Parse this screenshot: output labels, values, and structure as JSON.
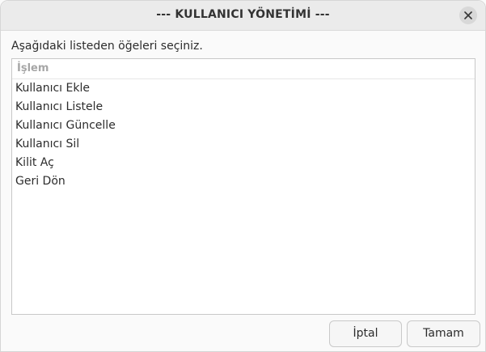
{
  "window": {
    "title": "--- KULLANICI YÖNETİMİ ---",
    "close_icon": "close-icon"
  },
  "prompt": "Aşağıdaki listeden öğeleri seçiniz.",
  "list": {
    "column_header": "İşlem",
    "items": [
      "Kullanıcı Ekle",
      "Kullanıcı Listele",
      "Kullanıcı Güncelle",
      "Kullanıcı Sil",
      "Kilit Aç",
      "Geri Dön"
    ]
  },
  "buttons": {
    "cancel_label": "İptal",
    "ok_label": "Tamam"
  }
}
